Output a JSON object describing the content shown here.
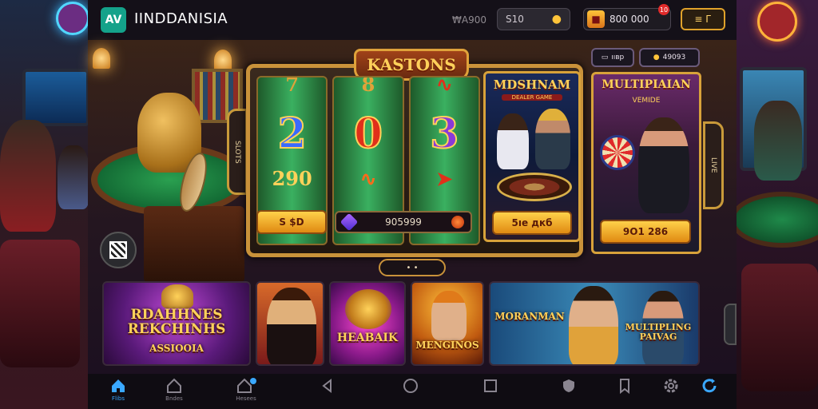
{
  "topbar": {
    "logo_text": "AV",
    "brand": "IINDDANISIA",
    "amount_text": "₩A900",
    "balance_value": "S10",
    "balance_icon": "coins-icon",
    "gift_value": "800 000",
    "gift_icon": "gift-icon",
    "notif_count": "10",
    "menu_label": "≡ Г"
  },
  "slot": {
    "title": "KASTONS",
    "reel_symbols": [
      {
        "top": "7",
        "mid": "2",
        "low": "290"
      },
      {
        "top": "8",
        "mid": "0",
        "low": ""
      },
      {
        "top": "",
        "mid": "3",
        "low": ""
      }
    ],
    "bet_button": "S $D",
    "credit_value": "905999",
    "pager_label": "• •"
  },
  "card_live": {
    "title": "MDSHNAM",
    "subtitle": "DEALER GAME",
    "button": "5ıе дкб"
  },
  "card_multi": {
    "title": "MULTIPIAIAN",
    "subtitle": "VEMIDE",
    "button": "9O1 286",
    "pill_1": "ııвр",
    "pill_2": "49093"
  },
  "left_side_tab": "SLOTS",
  "right_side_tab": "LIVE",
  "thumbnails": [
    {
      "title": "RDAHHNES\nREKCHINHS",
      "sub": "ASSIOOIA"
    },
    {
      "title": ""
    },
    {
      "title": "HEABAIK"
    },
    {
      "title": "MENGINOS"
    },
    {
      "title": "MORANMAN",
      "title_2": "MULTIPLING\nPAIVAG"
    }
  ],
  "nav": [
    {
      "label": "Flibs",
      "icon": "home-icon"
    },
    {
      "label": "Bndes",
      "icon": "house-outline-icon"
    },
    {
      "label": "Hesees",
      "icon": "store-icon"
    },
    {
      "label": "",
      "icon": "back-triangle-icon"
    },
    {
      "label": "",
      "icon": "home-circle-icon"
    },
    {
      "label": "",
      "icon": "recents-square-icon"
    },
    {
      "label": "",
      "icon": "shield-icon"
    },
    {
      "label": "",
      "icon": "bookmark-icon"
    },
    {
      "label": "",
      "icon": "settings-icon"
    },
    {
      "label": "",
      "icon": "refresh-icon"
    }
  ],
  "colors": {
    "accent_gold": "#e0a23a",
    "active_blue": "#3aa8ff",
    "logo_teal": "#14a28a"
  }
}
